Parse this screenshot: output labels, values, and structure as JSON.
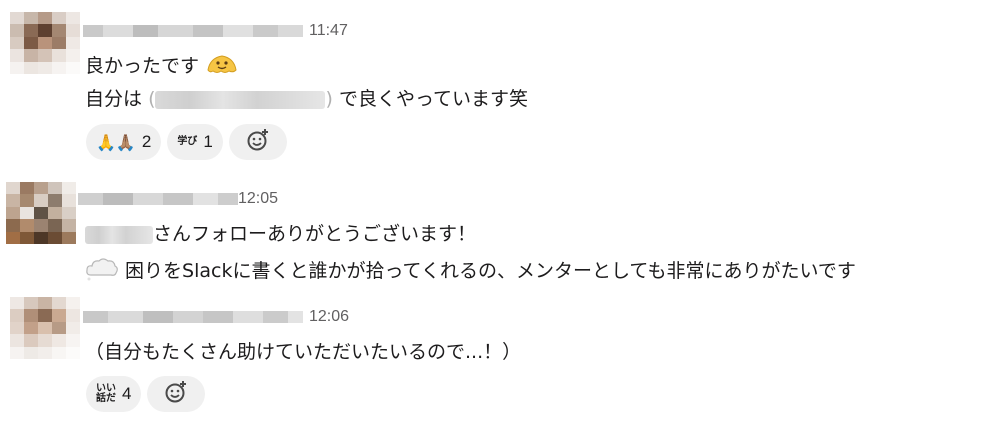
{
  "messages": [
    {
      "time": "11:47",
      "lines": [
        {
          "text": "良かったです",
          "emoji": "melting-face-icon"
        },
        {
          "prefix": "自分は",
          "suffix": "で良くやっています笑"
        }
      ],
      "reactions": [
        {
          "label": "🙏🙏🏽",
          "count": "2"
        },
        {
          "label": "学び",
          "count": "1"
        }
      ]
    },
    {
      "time": "12:05",
      "lines": [
        {
          "text": "さんフォローありがとうございます！"
        },
        {
          "emoji": "cloud-icon",
          "text": "困りをSlackに書くと誰かが拾ってくれるの、メンターとしても非常にありがたいです"
        }
      ]
    },
    {
      "time": "12:06",
      "lines": [
        {
          "text": "（自分もたくさん助けていただいたいるので...！）"
        }
      ],
      "reactions": [
        {
          "label_line1": "いい",
          "label_line2": "話だ",
          "count": "4"
        }
      ]
    }
  ],
  "colors": {
    "reaction_bg": "#f0f0f0",
    "time": "#616061",
    "text": "#1d1c1d"
  }
}
